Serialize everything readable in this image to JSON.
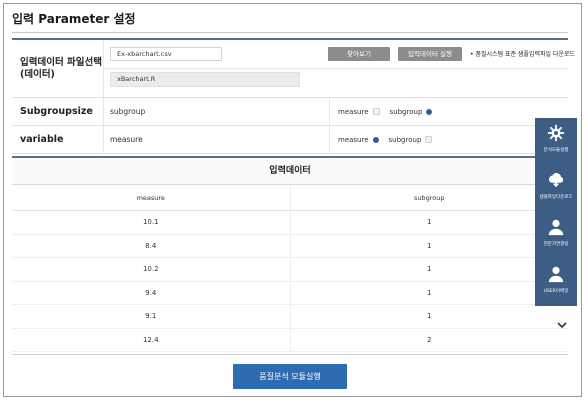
{
  "page": {
    "title": "입력 Parameter 설정"
  },
  "params": {
    "file": {
      "label": "입력데이터 파일선택\n(데이터)",
      "filename": "Ex-xbarchart.csv",
      "browse_label": "찾아보기",
      "run_input_label": "입력데이터 실행",
      "download_link": "• 품질시스템 표준 샘플입력파일 다운로드",
      "r_file": "xBarchart.R"
    },
    "subgroupsize": {
      "label": "Subgroupsize",
      "value": "subgroup",
      "opt1": "measure",
      "opt2": "subgroup",
      "selected": "subgroup"
    },
    "variable": {
      "label": "variable",
      "value": "measure",
      "opt1": "measure",
      "opt2": "subgroup",
      "selected": "measure"
    }
  },
  "input_data": {
    "title": "입력데이터",
    "columns": [
      "measure",
      "subgroup"
    ],
    "rows": [
      [
        "10.1",
        "1"
      ],
      [
        "8.4",
        "1"
      ],
      [
        "10.2",
        "1"
      ],
      [
        "9.4",
        "1"
      ],
      [
        "9.1",
        "1"
      ],
      [
        "12.4",
        "2"
      ]
    ]
  },
  "actions": {
    "run_module_label": "품질분석 모듈실행"
  },
  "side_panel": {
    "items": [
      {
        "icon": "gear-icon",
        "label": "분석모듈실행"
      },
      {
        "icon": "cloud-download-icon",
        "label": "샘플파일다운로드"
      },
      {
        "icon": "user-icon",
        "label": "전문가연결링"
      },
      {
        "icon": "user-icon",
        "label": "USER이메일"
      }
    ]
  },
  "colors": {
    "accent": "#2d6bb2",
    "side_panel": "#3d5d84",
    "radio_on": "#2f5e9a"
  }
}
